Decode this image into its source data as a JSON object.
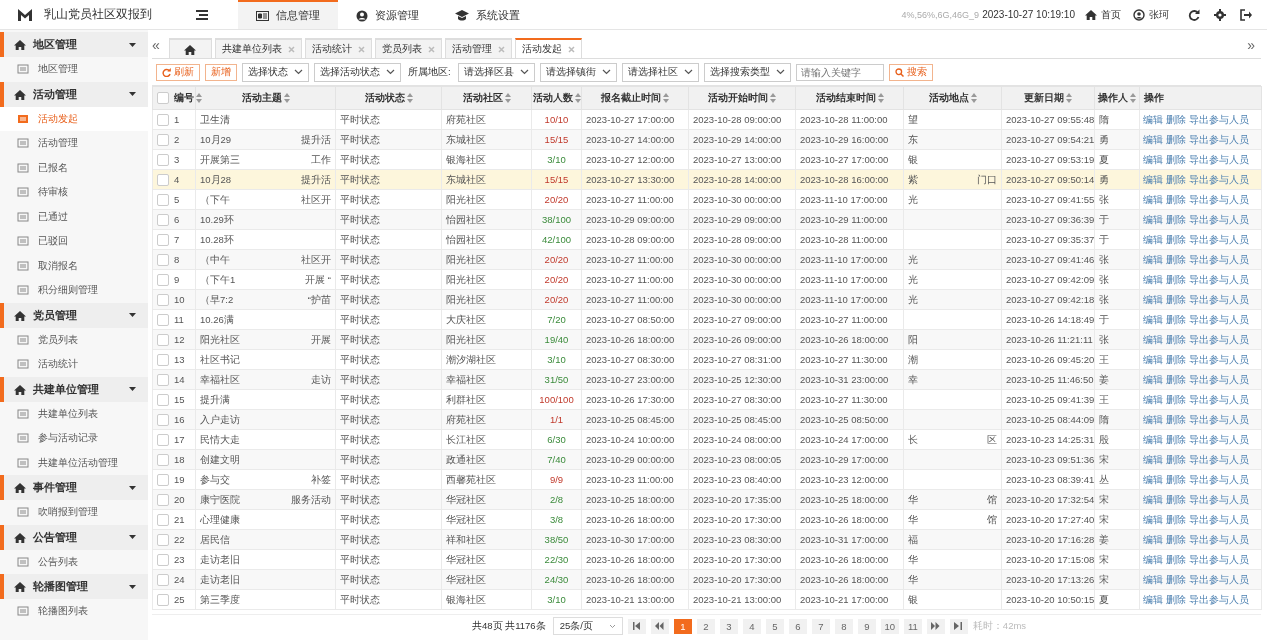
{
  "topbar": {
    "title": "乳山党员社区双报到",
    "nav": [
      {
        "label": "信息管理",
        "selected": true
      },
      {
        "label": "资源管理",
        "selected": false
      },
      {
        "label": "系统设置",
        "selected": false
      }
    ],
    "sysinfo": "4%,56%,6G,46G_9",
    "datetime": "2023-10-27 10:19:10",
    "home": "首页",
    "user": "张珂"
  },
  "sidebar": {
    "groups": [
      {
        "title": "地区管理",
        "expanded": true,
        "items": [
          {
            "label": "地区管理",
            "selected": false
          }
        ]
      },
      {
        "title": "活动管理",
        "expanded": true,
        "items": [
          {
            "label": "活动发起",
            "selected": true
          },
          {
            "label": "活动管理",
            "selected": false
          },
          {
            "label": "已报名",
            "selected": false
          },
          {
            "label": "待审核",
            "selected": false
          },
          {
            "label": "已通过",
            "selected": false
          },
          {
            "label": "已驳回",
            "selected": false
          },
          {
            "label": "取消报名",
            "selected": false
          },
          {
            "label": "积分细则管理",
            "selected": false
          }
        ]
      },
      {
        "title": "党员管理",
        "expanded": true,
        "items": [
          {
            "label": "党员列表",
            "selected": false
          },
          {
            "label": "活动统计",
            "selected": false
          }
        ]
      },
      {
        "title": "共建单位管理",
        "expanded": true,
        "items": [
          {
            "label": "共建单位列表",
            "selected": false
          },
          {
            "label": "参与活动记录",
            "selected": false
          },
          {
            "label": "共建单位活动管理",
            "selected": false
          }
        ]
      },
      {
        "title": "事件管理",
        "expanded": true,
        "items": [
          {
            "label": "吹哨报到管理",
            "selected": false
          }
        ]
      },
      {
        "title": "公告管理",
        "expanded": true,
        "items": [
          {
            "label": "公告列表",
            "selected": false
          }
        ]
      },
      {
        "title": "轮播图管理",
        "expanded": true,
        "items": [
          {
            "label": "轮播图列表",
            "selected": false
          }
        ]
      }
    ]
  },
  "tabs": {
    "prev": "«",
    "next": "»",
    "items": [
      {
        "label": "共建单位列表",
        "selected": false
      },
      {
        "label": "活动统计",
        "selected": false
      },
      {
        "label": "党员列表",
        "selected": false
      },
      {
        "label": "活动管理",
        "selected": false
      },
      {
        "label": "活动发起",
        "selected": true
      }
    ]
  },
  "toolbar": {
    "items": [
      {
        "kind": "refresh",
        "label": "刷新"
      },
      {
        "kind": "button",
        "label": "新增"
      },
      {
        "kind": "select",
        "label": "选择状态"
      },
      {
        "kind": "select",
        "label": "选择活动状态"
      },
      {
        "kind": "label",
        "label": "所属地区:"
      },
      {
        "kind": "select",
        "label": "请选择区县"
      },
      {
        "kind": "select",
        "label": "请选择镇街"
      },
      {
        "kind": "select",
        "label": "请选择社区"
      },
      {
        "kind": "select",
        "label": "选择搜索类型"
      },
      {
        "kind": "input",
        "placeholder": "请输入关键字"
      },
      {
        "kind": "search",
        "label": "搜索"
      }
    ]
  },
  "table": {
    "select_all_checked": false,
    "columns": [
      "编号",
      "活动主题",
      "活动状态",
      "活动社区",
      "活动人数",
      "报名截止时间",
      "活动开始时间",
      "活动结束时间",
      "活动地点",
      "更新日期",
      "操作人",
      "操作"
    ],
    "rows": [
      {
        "id": "1",
        "checked": false,
        "selected": false,
        "subject": {
          "start": "卫生清"
        },
        "status": "平时状态",
        "community": "府苑社区",
        "count": "10/10",
        "full": true,
        "deadline": "2023-10-27 17:00:00",
        "start": "2023-10-28 09:00:00",
        "end": "2023-10-28 11:00:00",
        "place": {
          "start": "望"
        },
        "updated": "2023-10-27 09:55:48",
        "operator": "隋",
        "actions": [
          "编辑",
          "删除",
          "导出参与人员"
        ]
      },
      {
        "id": "2",
        "checked": false,
        "selected": false,
        "subject": {
          "start": "10月29",
          "end": "提升活"
        },
        "status": "平时状态",
        "community": "东城社区",
        "count": "15/15",
        "full": true,
        "deadline": "2023-10-27 14:00:00",
        "start": "2023-10-29 14:00:00",
        "end": "2023-10-29 16:00:00",
        "place": {
          "start": "东"
        },
        "updated": "2023-10-27 09:54:21",
        "operator": "勇",
        "actions": [
          "编辑",
          "删除",
          "导出参与人员"
        ]
      },
      {
        "id": "3",
        "checked": false,
        "selected": false,
        "subject": {
          "start": "开展第三",
          "end": "工作"
        },
        "status": "平时状态",
        "community": "银海社区",
        "count": "3/10",
        "full": false,
        "deadline": "2023-10-27 12:00:00",
        "start": "2023-10-27 13:00:00",
        "end": "2023-10-27 17:00:00",
        "place": {
          "start": "银"
        },
        "updated": "2023-10-27 09:53:19",
        "operator": "夏",
        "actions": [
          "编辑",
          "删除",
          "导出参与人员"
        ]
      },
      {
        "id": "4",
        "checked": false,
        "selected": true,
        "subject": {
          "start": "10月28",
          "end": "提升活"
        },
        "status": "平时状态",
        "community": "东城社区",
        "count": "15/15",
        "full": true,
        "deadline": "2023-10-27 13:30:00",
        "start": "2023-10-28 14:00:00",
        "end": "2023-10-28 16:00:00",
        "place": {
          "start": "紫",
          "end": "门口"
        },
        "updated": "2023-10-27 09:50:14",
        "operator": "勇",
        "actions": [
          "编辑",
          "删除",
          "导出参与人员"
        ]
      },
      {
        "id": "5",
        "checked": false,
        "selected": false,
        "subject": {
          "start": "（下午",
          "end": "社区开"
        },
        "status": "平时状态",
        "community": "阳光社区",
        "count": "20/20",
        "full": true,
        "deadline": "2023-10-27 11:00:00",
        "start": "2023-10-30 00:00:00",
        "end": "2023-11-10 17:00:00",
        "place": {
          "start": "光"
        },
        "updated": "2023-10-27 09:41:55",
        "operator": "张",
        "actions": [
          "编辑",
          "删除",
          "导出参与人员"
        ]
      },
      {
        "id": "6",
        "checked": false,
        "selected": false,
        "subject": {
          "start": "10.29环"
        },
        "status": "平时状态",
        "community": "怡园社区",
        "count": "38/100",
        "full": false,
        "deadline": "2023-10-29 09:00:00",
        "start": "2023-10-29 09:00:00",
        "end": "2023-10-29 11:00:00",
        "updated": "2023-10-27 09:36:39",
        "operator": "于",
        "actions": [
          "编辑",
          "删除",
          "导出参与人员"
        ]
      },
      {
        "id": "7",
        "checked": false,
        "selected": false,
        "subject": {
          "start": "10.28环"
        },
        "status": "平时状态",
        "community": "怡园社区",
        "count": "42/100",
        "full": false,
        "deadline": "2023-10-28 09:00:00",
        "start": "2023-10-28 09:00:00",
        "end": "2023-10-28 11:00:00",
        "updated": "2023-10-27 09:35:37",
        "operator": "于",
        "actions": [
          "编辑",
          "删除",
          "导出参与人员"
        ]
      },
      {
        "id": "8",
        "checked": false,
        "selected": false,
        "subject": {
          "start": "（中午",
          "end": "社区开"
        },
        "status": "平时状态",
        "community": "阳光社区",
        "count": "20/20",
        "full": true,
        "deadline": "2023-10-27 11:00:00",
        "start": "2023-10-30 00:00:00",
        "end": "2023-11-10 17:00:00",
        "place": {
          "start": "光"
        },
        "updated": "2023-10-27 09:41:46",
        "operator": "张",
        "actions": [
          "编辑",
          "删除",
          "导出参与人员"
        ]
      },
      {
        "id": "9",
        "checked": false,
        "selected": false,
        "subject": {
          "start": "（下午1",
          "end": "开展 “"
        },
        "status": "平时状态",
        "community": "阳光社区",
        "count": "20/20",
        "full": true,
        "deadline": "2023-10-27 11:00:00",
        "start": "2023-10-30 00:00:00",
        "end": "2023-11-10 17:00:00",
        "place": {
          "start": "光"
        },
        "updated": "2023-10-27 09:42:09",
        "operator": "张",
        "actions": [
          "编辑",
          "删除",
          "导出参与人员"
        ]
      },
      {
        "id": "10",
        "checked": false,
        "selected": false,
        "subject": {
          "start": "（早7:2",
          "end": "“护苗"
        },
        "status": "平时状态",
        "community": "阳光社区",
        "count": "20/20",
        "full": true,
        "deadline": "2023-10-27 11:00:00",
        "start": "2023-10-30 00:00:00",
        "end": "2023-11-10 17:00:00",
        "place": {
          "start": "光"
        },
        "updated": "2023-10-27 09:42:18",
        "operator": "张",
        "actions": [
          "编辑",
          "删除",
          "导出参与人员"
        ]
      },
      {
        "id": "11",
        "checked": false,
        "selected": false,
        "subject": {
          "start": "10.26满"
        },
        "status": "平时状态",
        "community": "大庆社区",
        "count": "7/20",
        "full": false,
        "deadline": "2023-10-27 08:50:00",
        "start": "2023-10-27 09:00:00",
        "end": "2023-10-27 11:00:00",
        "updated": "2023-10-26 14:18:49",
        "operator": "于",
        "actions": [
          "编辑",
          "删除",
          "导出参与人员"
        ]
      },
      {
        "id": "12",
        "checked": false,
        "selected": false,
        "subject": {
          "start": "阳光社区",
          "end": "开展"
        },
        "status": "平时状态",
        "community": "阳光社区",
        "count": "19/40",
        "full": false,
        "deadline": "2023-10-26 18:00:00",
        "start": "2023-10-26 09:00:00",
        "end": "2023-10-26 18:00:00",
        "place": {
          "start": "阳"
        },
        "updated": "2023-10-26 11:21:11",
        "operator": "张",
        "actions": [
          "编辑",
          "删除",
          "导出参与人员"
        ]
      },
      {
        "id": "13",
        "checked": false,
        "selected": false,
        "subject": {
          "start": "社区书记"
        },
        "status": "平时状态",
        "community": "潮汐湖社区",
        "count": "3/10",
        "full": false,
        "deadline": "2023-10-27 08:30:00",
        "start": "2023-10-27 08:31:00",
        "end": "2023-10-27 11:30:00",
        "place": {
          "start": "潮"
        },
        "updated": "2023-10-26 09:45:20",
        "operator": "王",
        "actions": [
          "编辑",
          "删除",
          "导出参与人员"
        ]
      },
      {
        "id": "14",
        "checked": false,
        "selected": false,
        "subject": {
          "start": "幸福社区",
          "end": "走访"
        },
        "status": "平时状态",
        "community": "幸福社区",
        "count": "31/50",
        "full": false,
        "deadline": "2023-10-27 23:00:00",
        "start": "2023-10-25 12:30:00",
        "end": "2023-10-31 23:00:00",
        "place": {
          "start": "幸"
        },
        "updated": "2023-10-25 11:46:50",
        "operator": "姜",
        "actions": [
          "编辑",
          "删除",
          "导出参与人员"
        ]
      },
      {
        "id": "15",
        "checked": false,
        "selected": false,
        "subject": {
          "start": "提升满"
        },
        "status": "平时状态",
        "community": "利群社区",
        "count": "100/100",
        "full": true,
        "deadline": "2023-10-26 17:30:00",
        "start": "2023-10-27 08:30:00",
        "end": "2023-10-27 11:30:00",
        "updated": "2023-10-25 09:41:39",
        "operator": "王",
        "actions": [
          "编辑",
          "删除",
          "导出参与人员"
        ]
      },
      {
        "id": "16",
        "checked": false,
        "selected": false,
        "subject": {
          "start": "入户走访"
        },
        "status": "平时状态",
        "community": "府苑社区",
        "count": "1/1",
        "full": true,
        "deadline": "2023-10-25 08:45:00",
        "start": "2023-10-25 08:45:00",
        "end": "2023-10-25 08:50:00",
        "updated": "2023-10-25 08:44:09",
        "operator": "隋",
        "actions": [
          "编辑",
          "删除",
          "导出参与人员"
        ]
      },
      {
        "id": "17",
        "checked": false,
        "selected": false,
        "subject": {
          "start": "民情大走"
        },
        "status": "平时状态",
        "community": "长江社区",
        "count": "6/30",
        "full": false,
        "deadline": "2023-10-24 10:00:00",
        "start": "2023-10-24 08:00:00",
        "end": "2023-10-24 17:00:00",
        "place": {
          "start": "长",
          "end": "区"
        },
        "updated": "2023-10-23 14:25:31",
        "operator": "殷",
        "actions": [
          "编辑",
          "删除",
          "导出参与人员"
        ]
      },
      {
        "id": "18",
        "checked": false,
        "selected": false,
        "subject": {
          "start": "创建文明"
        },
        "status": "平时状态",
        "community": "政通社区",
        "count": "7/40",
        "full": false,
        "deadline": "2023-10-29 00:00:00",
        "start": "2023-10-23 08:00:05",
        "end": "2023-10-29 17:00:00",
        "updated": "2023-10-23 09:51:36",
        "operator": "宋",
        "actions": [
          "编辑",
          "删除",
          "导出参与人员"
        ]
      },
      {
        "id": "19",
        "checked": false,
        "selected": false,
        "subject": {
          "start": "参与交",
          "end": "补签"
        },
        "status": "平时状态",
        "community": "西馨苑社区",
        "count": "9/9",
        "full": true,
        "deadline": "2023-10-23 11:00:00",
        "start": "2023-10-23 08:40:00",
        "end": "2023-10-23 12:00:00",
        "updated": "2023-10-23 08:39:41",
        "operator": "丛",
        "actions": [
          "编辑",
          "删除",
          "导出参与人员"
        ]
      },
      {
        "id": "20",
        "checked": false,
        "selected": false,
        "subject": {
          "start": "康宁医院",
          "end": "服务活动"
        },
        "status": "平时状态",
        "community": "华冠社区",
        "count": "2/8",
        "full": false,
        "deadline": "2023-10-25 18:00:00",
        "start": "2023-10-20 17:35:00",
        "end": "2023-10-25 18:00:00",
        "place": {
          "start": "华",
          "end": "馆"
        },
        "updated": "2023-10-20 17:32:54",
        "operator": "宋",
        "actions": [
          "编辑",
          "删除",
          "导出参与人员"
        ]
      },
      {
        "id": "21",
        "checked": false,
        "selected": false,
        "subject": {
          "start": "心理健康"
        },
        "status": "平时状态",
        "community": "华冠社区",
        "count": "3/8",
        "full": false,
        "deadline": "2023-10-26 18:00:00",
        "start": "2023-10-20 17:30:00",
        "end": "2023-10-26 18:00:00",
        "place": {
          "start": "华",
          "end": "馆"
        },
        "updated": "2023-10-20 17:27:40",
        "operator": "宋",
        "actions": [
          "编辑",
          "删除",
          "导出参与人员"
        ]
      },
      {
        "id": "22",
        "checked": false,
        "selected": false,
        "subject": {
          "start": "居民信"
        },
        "status": "平时状态",
        "community": "祥和社区",
        "count": "38/50",
        "full": false,
        "deadline": "2023-10-30 17:00:00",
        "start": "2023-10-23 08:30:00",
        "end": "2023-10-31 17:00:00",
        "place": {
          "start": "福"
        },
        "updated": "2023-10-20 17:16:28",
        "operator": "姜",
        "actions": [
          "编辑",
          "删除",
          "导出参与人员"
        ]
      },
      {
        "id": "23",
        "checked": false,
        "selected": false,
        "subject": {
          "start": "走访老旧"
        },
        "status": "平时状态",
        "community": "华冠社区",
        "count": "22/30",
        "full": false,
        "deadline": "2023-10-26 18:00:00",
        "start": "2023-10-20 17:30:00",
        "end": "2023-10-26 18:00:00",
        "place": {
          "start": "华"
        },
        "updated": "2023-10-20 17:15:08",
        "operator": "宋",
        "actions": [
          "编辑",
          "删除",
          "导出参与人员"
        ]
      },
      {
        "id": "24",
        "checked": false,
        "selected": false,
        "subject": {
          "start": "走访老旧"
        },
        "status": "平时状态",
        "community": "华冠社区",
        "count": "24/30",
        "full": false,
        "deadline": "2023-10-26 18:00:00",
        "start": "2023-10-20 17:30:00",
        "end": "2023-10-26 18:00:00",
        "place": {
          "start": "华"
        },
        "updated": "2023-10-20 17:13:26",
        "operator": "宋",
        "actions": [
          "编辑",
          "删除",
          "导出参与人员"
        ]
      },
      {
        "id": "25",
        "checked": false,
        "selected": false,
        "subject": {
          "start": "第三季度"
        },
        "status": "平时状态",
        "community": "银海社区",
        "count": "3/10",
        "full": false,
        "deadline": "2023-10-21 13:00:00",
        "start": "2023-10-21 13:00:00",
        "end": "2023-10-21 17:00:00",
        "place": {
          "start": "银"
        },
        "updated": "2023-10-20 10:50:15",
        "operator": "夏",
        "actions": [
          "编辑",
          "删除",
          "导出参与人员"
        ]
      }
    ]
  },
  "pagination": {
    "summary": "共48页 共1176条",
    "page_size": "25条/页",
    "pages": [
      {
        "label": "1",
        "selected": true
      },
      {
        "label": "2",
        "selected": false
      },
      {
        "label": "3",
        "selected": false
      },
      {
        "label": "4",
        "selected": false
      },
      {
        "label": "5",
        "selected": false
      },
      {
        "label": "6",
        "selected": false
      },
      {
        "label": "7",
        "selected": false
      },
      {
        "label": "8",
        "selected": false
      },
      {
        "label": "9",
        "selected": false
      },
      {
        "label": "10",
        "selected": false
      },
      {
        "label": "11",
        "selected": false
      }
    ],
    "elapsed": "耗时：42ms"
  }
}
